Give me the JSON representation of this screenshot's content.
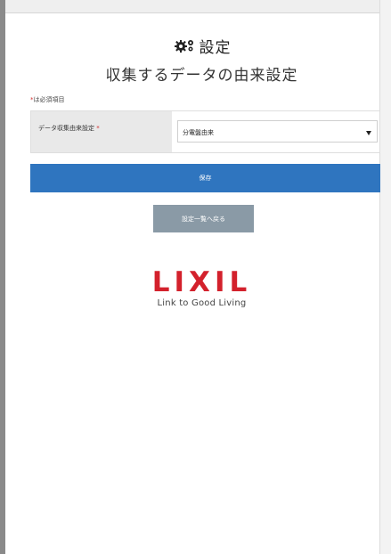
{
  "header": {
    "title": "設定",
    "subtitle": "収集するデータの由来設定",
    "title_icon": "gears-icon"
  },
  "form": {
    "required_note_star": "*",
    "required_note": "は必須項目",
    "field_label": "データ収集由来設定",
    "field_required_star": "*",
    "select_value": "分電盤由来"
  },
  "buttons": {
    "save_label": "保存",
    "back_label": "設定一覧へ戻る"
  },
  "logo": {
    "wordmark": "LIXIL",
    "tagline": "Link to Good Living"
  },
  "colors": {
    "primary": "#2f75bf",
    "secondary": "#8a9aa6",
    "brand": "#d3212c",
    "required": "#d23030"
  }
}
